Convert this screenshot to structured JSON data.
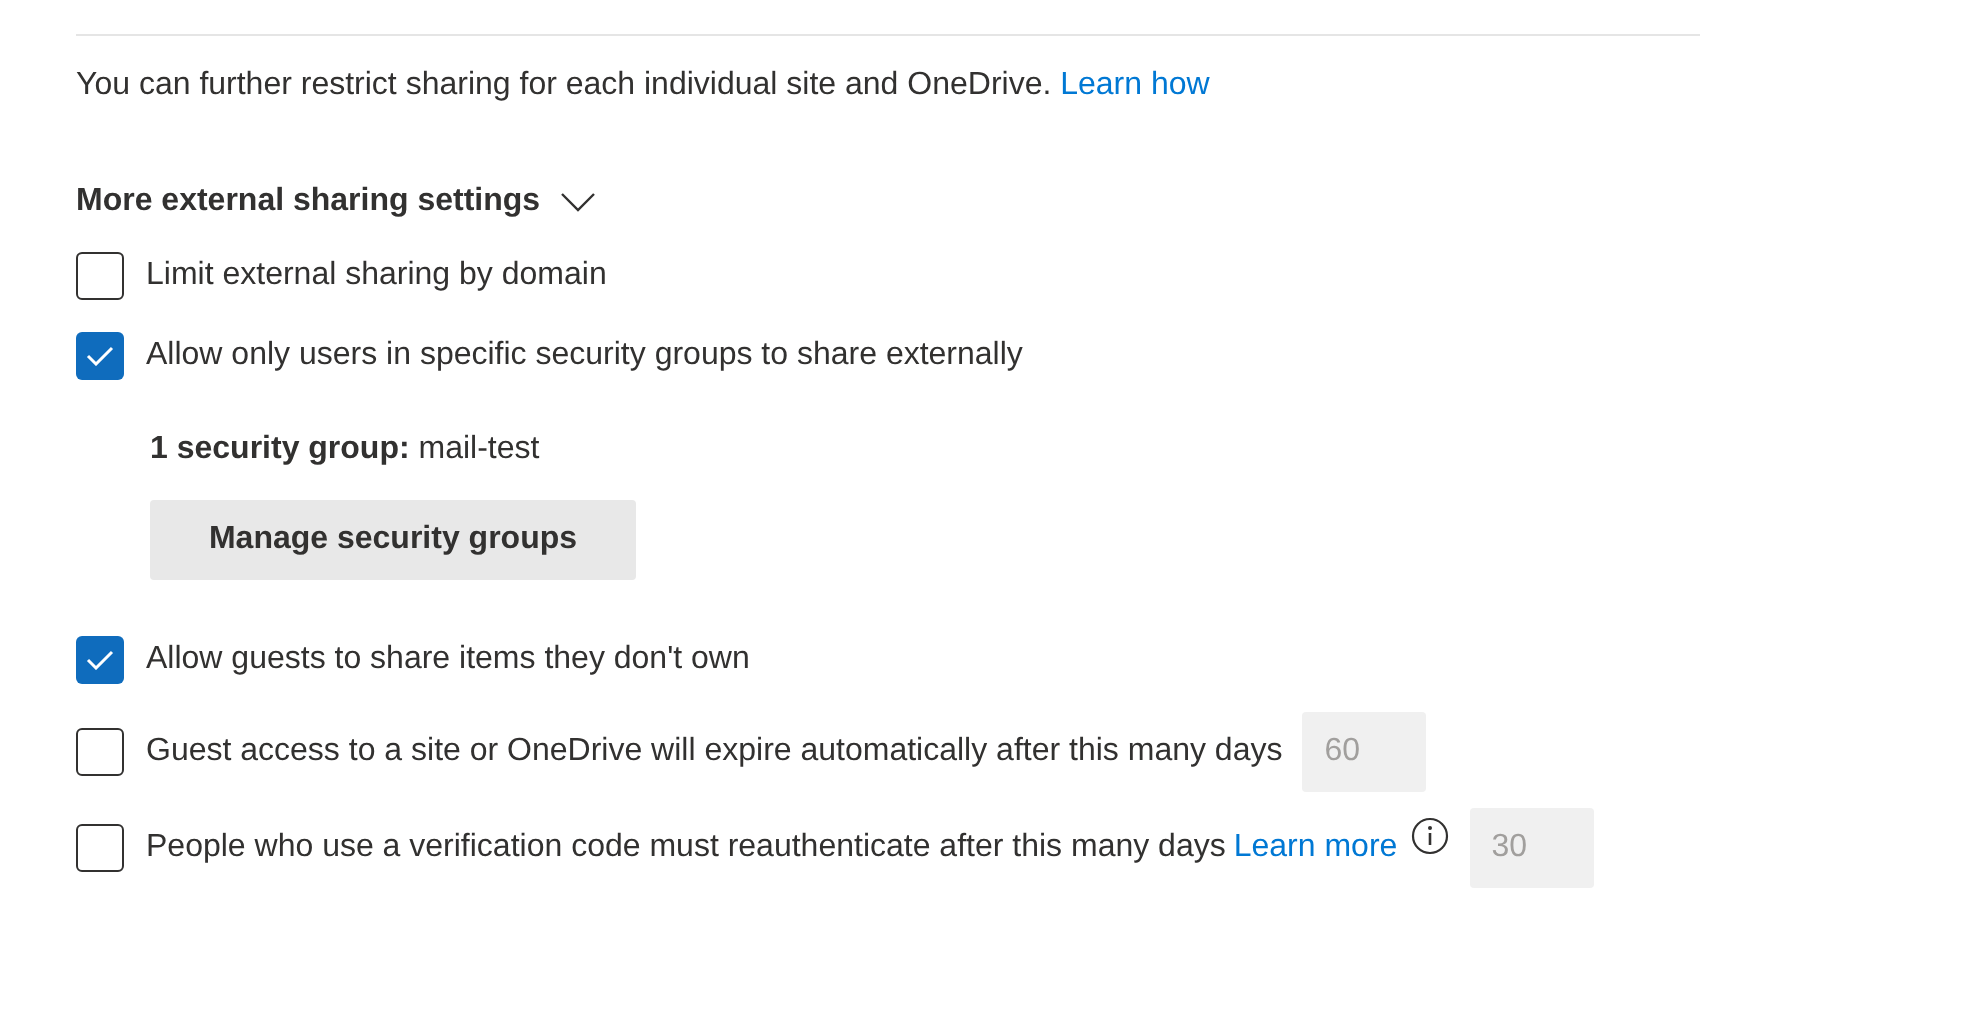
{
  "intro": {
    "text": "You can further restrict sharing for each individual site and OneDrive.",
    "link": "Learn how"
  },
  "section": {
    "title": "More external sharing settings",
    "expanded": true
  },
  "options": [
    {
      "label": "Limit external sharing by domain",
      "checked": false
    },
    {
      "label": "Allow only users in specific security groups to share externally",
      "checked": true,
      "detail": {
        "label": "1 security group:",
        "value": "mail-test",
        "button": "Manage security groups"
      }
    },
    {
      "label": "Allow guests to share items they don't own",
      "checked": true
    },
    {
      "label": "Guest access to a site or OneDrive will expire automatically after this many days",
      "checked": false,
      "days_field": {
        "value": "60",
        "disabled": true
      }
    },
    {
      "label": "People who use a verification code must reauthenticate after this many days",
      "checked": false,
      "link": "Learn more",
      "info": true,
      "days_field": {
        "value": "30",
        "disabled": true
      }
    }
  ]
}
